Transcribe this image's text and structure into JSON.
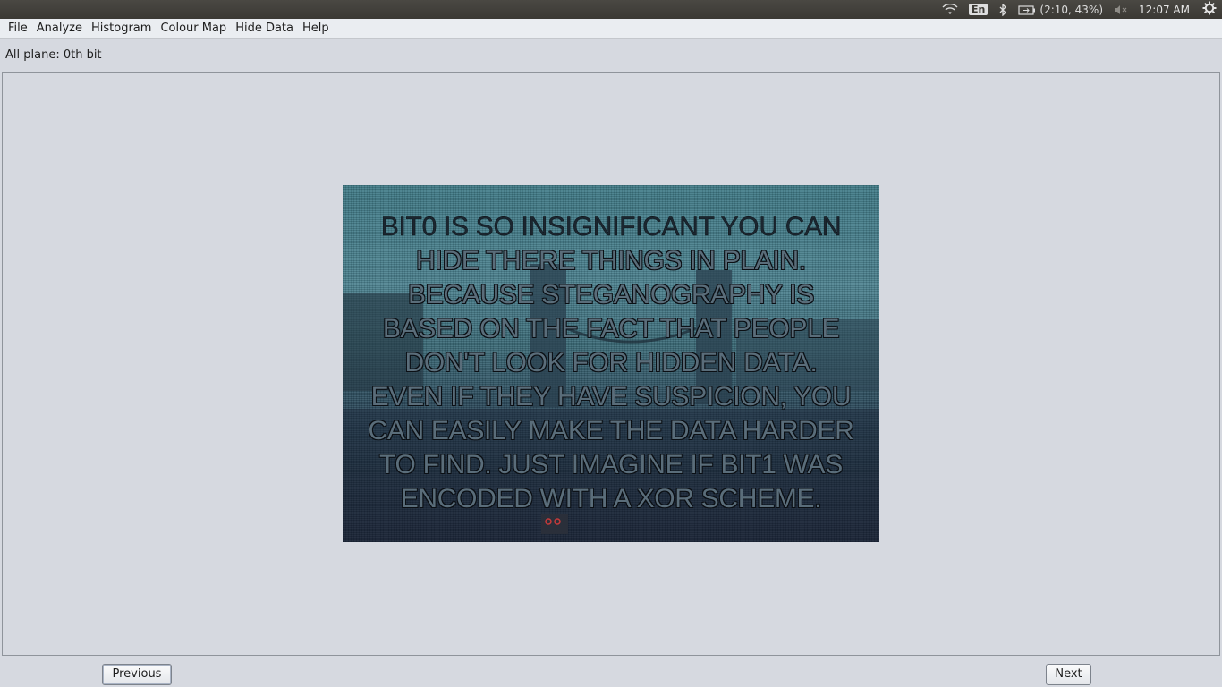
{
  "system_panel": {
    "wifi_icon": "wifi-icon",
    "keyboard_layout": "En",
    "bluetooth_icon": "bluetooth-icon",
    "battery_text": "(2:10, 43%)",
    "volume_icon": "volume-muted-icon",
    "clock": "12:07 AM",
    "settings_icon": "gear-icon"
  },
  "menubar": {
    "items": [
      {
        "label": "File"
      },
      {
        "label": "Analyze"
      },
      {
        "label": "Histogram"
      },
      {
        "label": "Colour Map"
      },
      {
        "label": "Hide Data"
      },
      {
        "label": "Help"
      }
    ]
  },
  "status": {
    "plane_label": "All plane: 0th bit"
  },
  "image": {
    "lines": [
      "BIT0 IS SO INSIGNIFICANT YOU CAN",
      "HIDE THERE THINGS IN PLAIN.",
      "BECAUSE STEGANOGRAPHY IS",
      "BASED ON THE FACT THAT PEOPLE",
      "DON'T LOOK FOR HIDDEN DATA.",
      "EVEN IF THEY HAVE SUSPICION, YOU",
      "CAN EASILY MAKE THE DATA HARDER",
      "TO FIND. JUST IMAGINE IF BIT1 WAS",
      "ENCODED WITH A  XOR SCHEME."
    ]
  },
  "buttons": {
    "previous": "Previous",
    "next": "Next"
  }
}
